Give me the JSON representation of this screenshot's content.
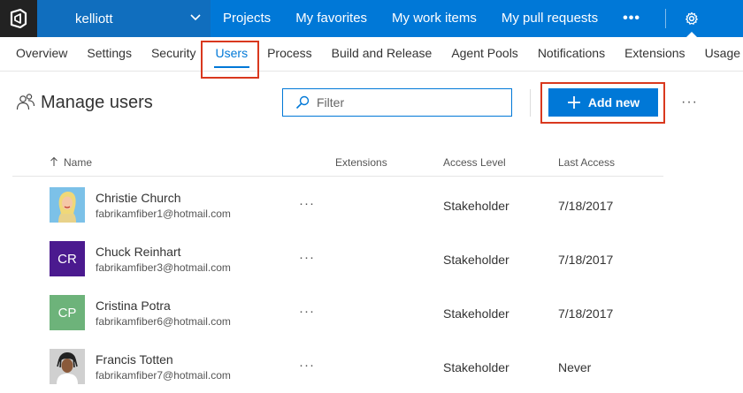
{
  "topbar": {
    "org_name": "kelliott",
    "nav": [
      "Projects",
      "My favorites",
      "My work items",
      "My pull requests"
    ],
    "more": "•••"
  },
  "subnav": [
    "Overview",
    "Settings",
    "Security",
    "Users",
    "Process",
    "Build and Release",
    "Agent Pools",
    "Notifications",
    "Extensions",
    "Usage"
  ],
  "page": {
    "title": "Manage users",
    "filter_placeholder": "Filter",
    "add_label": "Add new",
    "more": "···"
  },
  "table": {
    "headers": {
      "name": "Name",
      "extensions": "Extensions",
      "access": "Access Level",
      "last_access": "Last Access"
    },
    "row_more": "···",
    "rows": [
      {
        "name": "Christie Church",
        "email": "fabrikamfiber1@hotmail.com",
        "initials": "",
        "avatar_color": "#6fb6e0",
        "access": "Stakeholder",
        "last_access": "7/18/2017"
      },
      {
        "name": "Chuck Reinhart",
        "email": "fabrikamfiber3@hotmail.com",
        "initials": "CR",
        "avatar_color": "#4b1a8f",
        "access": "Stakeholder",
        "last_access": "7/18/2017"
      },
      {
        "name": "Cristina Potra",
        "email": "fabrikamfiber6@hotmail.com",
        "initials": "CP",
        "avatar_color": "#6db37a",
        "access": "Stakeholder",
        "last_access": "7/18/2017"
      },
      {
        "name": "Francis Totten",
        "email": "fabrikamfiber7@hotmail.com",
        "initials": "",
        "avatar_color": "#c8c8c8",
        "access": "Stakeholder",
        "last_access": "Never"
      }
    ]
  },
  "colors": {
    "accent": "#0078d7",
    "highlight": "#d9381e",
    "logo_bg": "#222222"
  }
}
